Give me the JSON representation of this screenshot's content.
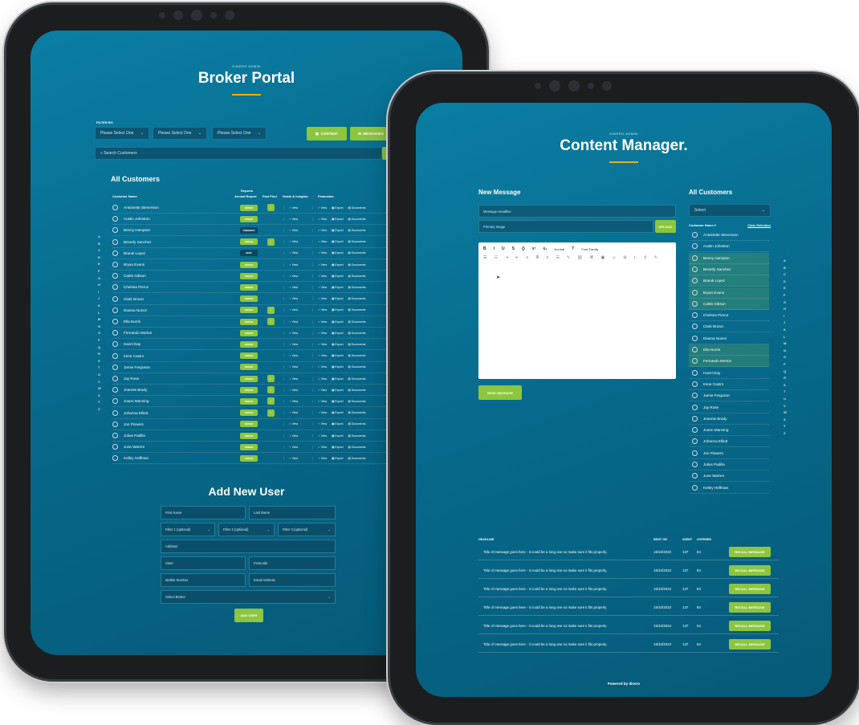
{
  "broker_portal": {
    "eyebrow": "DINERO ADMIN",
    "title": "Broker Portal",
    "filter_label": "FILTER BY:",
    "filters": [
      "Please Select One",
      "Please Select One",
      "Please Select One"
    ],
    "content_btn": "CONTENT",
    "messages_btn": "MESSAGES",
    "search_placeholder": "Search Customers",
    "section_title": "All Customers",
    "reports_label": "Reports",
    "columns": [
      "Customer Name",
      "Annual Report",
      "Fact Find",
      "Goals & Insights",
      "Financials"
    ],
    "order_label": "ORDER",
    "ordered_label": "ORDERED",
    "sent_label": "SENT",
    "view_label": "View",
    "export_label": "Export",
    "documents_label": "Documents",
    "customers": [
      {
        "name": "Antoinette Stevenson",
        "report": "order",
        "fact": true
      },
      {
        "name": "Austin Johnston",
        "report": "order",
        "fact": false
      },
      {
        "name": "Benny Hampton",
        "report": "ordered",
        "fact": false
      },
      {
        "name": "Beverly Sanchez",
        "report": "order",
        "fact": true
      },
      {
        "name": "Brandi Lopez",
        "report": "sent",
        "fact": false
      },
      {
        "name": "Bryan Evans",
        "report": "order",
        "fact": false
      },
      {
        "name": "Caleb Gibson",
        "report": "order",
        "fact": false
      },
      {
        "name": "Chelsea Pierce",
        "report": "order",
        "fact": false
      },
      {
        "name": "Clark Brown",
        "report": "order",
        "fact": false
      },
      {
        "name": "Dianna Nunez",
        "report": "order",
        "fact": true
      },
      {
        "name": "Ella Norris",
        "report": "order",
        "fact": true
      },
      {
        "name": "Fernando Morton",
        "report": "order",
        "fact": false
      },
      {
        "name": "Hazel Day",
        "report": "order",
        "fact": false
      },
      {
        "name": "Irene Castro",
        "report": "order",
        "fact": false
      },
      {
        "name": "Jamie Ferguson",
        "report": "order",
        "fact": false
      },
      {
        "name": "Jay Rose",
        "report": "order",
        "fact": true
      },
      {
        "name": "Jeannie Brady",
        "report": "order",
        "fact": true
      },
      {
        "name": "Joann Manning",
        "report": "order",
        "fact": true
      },
      {
        "name": "Johanna Elliott",
        "report": "order",
        "fact": true
      },
      {
        "name": "Jon Flowers",
        "report": "order",
        "fact": false
      },
      {
        "name": "Julius Padilla",
        "report": "order",
        "fact": false
      },
      {
        "name": "June Warren",
        "report": "order",
        "fact": false
      },
      {
        "name": "Kelley Hoffman",
        "report": "order",
        "fact": false
      }
    ],
    "alphabet": [
      "A",
      "B",
      "C",
      "D",
      "E",
      "F",
      "G",
      "H",
      "I",
      "J",
      "K",
      "L",
      "M",
      "N",
      "O",
      "P",
      "Q",
      "R",
      "S",
      "T",
      "U",
      "V",
      "W",
      "X",
      "Y",
      "Z"
    ],
    "add_user": {
      "title": "Add New User",
      "first_name": "First Name",
      "last_name": "Last Name",
      "filter1": "Filter 1 (optional)",
      "filter2": "Filter 2 (optional)",
      "filter3": "Filter 3 (optional)",
      "address": "Address",
      "state": "State",
      "postcode": "Postcode",
      "mobile": "Mobile Number",
      "email": "Email Address",
      "broker": "Select Broker",
      "submit": "ADD USER"
    }
  },
  "content_manager": {
    "eyebrow": "DINERO ADMIN",
    "title": "Content Manager.",
    "new_message": "New Message",
    "headline_placeholder": "Message Headline",
    "image_placeholder": "Primary Image",
    "upload_btn": "UPLOAD",
    "toolbar": [
      "B",
      "I",
      "U",
      "S",
      "{}",
      "x²",
      "x₂",
      "Normal",
      "T",
      "Font-Family"
    ],
    "send_btn": "SEND MESSAGE",
    "all_customers": "All Customers",
    "select_label": "Select",
    "customer_name_label": "Customer Name",
    "clear_selection": "Clear Selection",
    "customers": [
      {
        "name": "Antoinette Stevenson",
        "selected": false
      },
      {
        "name": "Austin Johnston",
        "selected": false
      },
      {
        "name": "Benny Hampton",
        "selected": true
      },
      {
        "name": "Beverly Sanchez",
        "selected": true
      },
      {
        "name": "Brandi Lopez",
        "selected": true
      },
      {
        "name": "Bryan Evans",
        "selected": true
      },
      {
        "name": "Caleb Gibson",
        "selected": true
      },
      {
        "name": "Chelsea Pierce",
        "selected": false
      },
      {
        "name": "Clark Brown",
        "selected": false
      },
      {
        "name": "Dianna Nunez",
        "selected": false
      },
      {
        "name": "Ella Norris",
        "selected": true
      },
      {
        "name": "Fernando Morton",
        "selected": true
      },
      {
        "name": "Hazel Day",
        "selected": false
      },
      {
        "name": "Irene Castro",
        "selected": false
      },
      {
        "name": "Jamie Ferguson",
        "selected": false
      },
      {
        "name": "Jay Rose",
        "selected": false
      },
      {
        "name": "Jeannie Brady",
        "selected": false
      },
      {
        "name": "Joann Manning",
        "selected": false
      },
      {
        "name": "Johanna Elliott",
        "selected": false
      },
      {
        "name": "Jon Flowers",
        "selected": false
      },
      {
        "name": "Julius Padilla",
        "selected": false
      },
      {
        "name": "June Warren",
        "selected": false
      },
      {
        "name": "Kelley Hoffman",
        "selected": false
      }
    ],
    "messages_header": {
      "headline": "HEADLINE",
      "sent_on": "SENT ON",
      "sent": "#SENT",
      "opened": "#OPENED"
    },
    "messages": [
      {
        "title": "Title of message goes here - it could be a long one so make sure it fits properly.",
        "date": "15/10/2023",
        "sent": "137",
        "opened": "84"
      },
      {
        "title": "Title of message goes here - it could be a long one so make sure it fits properly.",
        "date": "15/10/2023",
        "sent": "137",
        "opened": "84"
      },
      {
        "title": "Title of message goes here - it could be a long one so make sure it fits properly.",
        "date": "15/10/2023",
        "sent": "137",
        "opened": "84"
      },
      {
        "title": "Title of message goes here - it could be a long one so make sure it fits properly.",
        "date": "15/10/2023",
        "sent": "137",
        "opened": "84"
      },
      {
        "title": "Title of message goes here - it could be a long one so make sure it fits properly.",
        "date": "15/10/2023",
        "sent": "137",
        "opened": "84"
      },
      {
        "title": "Title of message goes here - it could be a long one so make sure it fits properly.",
        "date": "15/10/2023",
        "sent": "137",
        "opened": "84"
      }
    ],
    "recall_btn": "RECALL MESSAGE",
    "footer": "Powered by dinero"
  },
  "colors": {
    "accent": "#8cc63f",
    "underline": "#e3b21b",
    "bg": "#076a8c"
  }
}
